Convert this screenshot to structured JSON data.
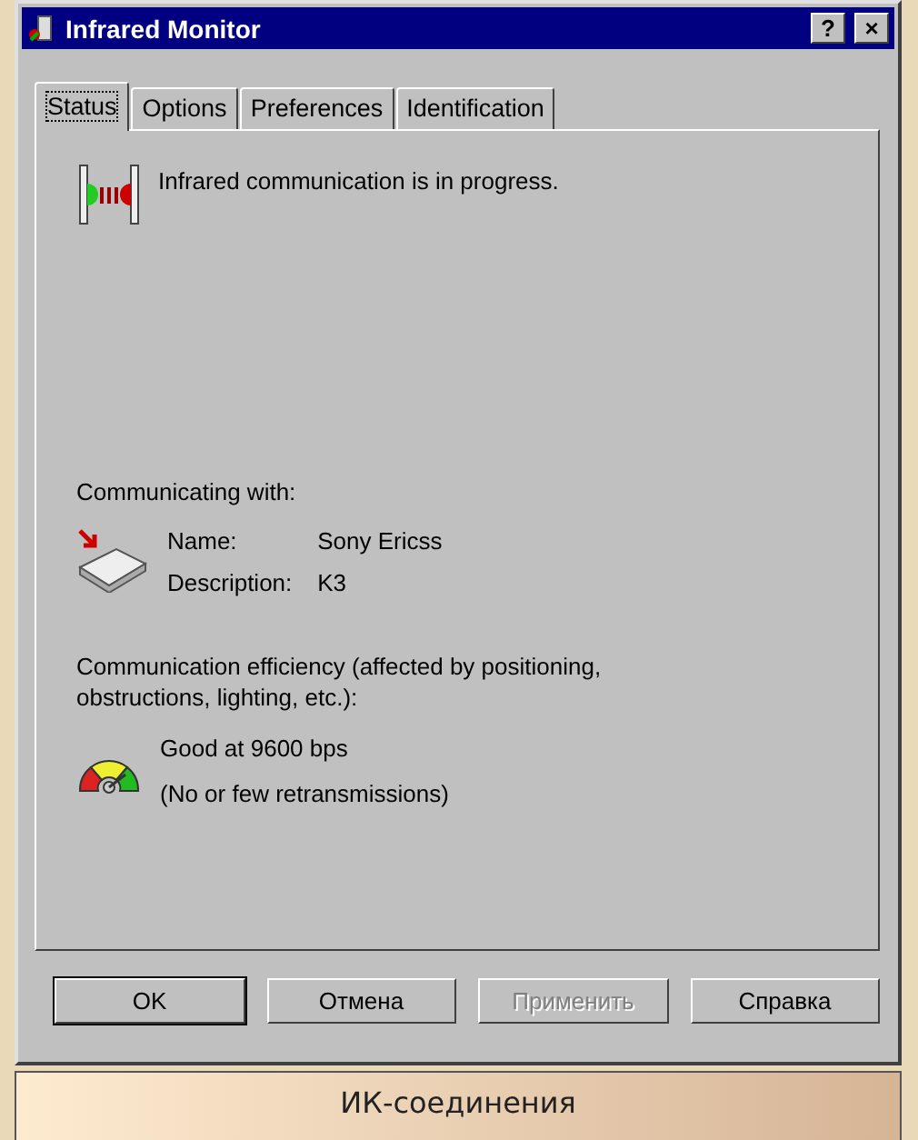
{
  "window": {
    "title": "Infrared Monitor",
    "help_button": "?",
    "close_button": "×"
  },
  "tabs": [
    {
      "label": "Status",
      "selected": true
    },
    {
      "label": "Options",
      "selected": false
    },
    {
      "label": "Preferences",
      "selected": false
    },
    {
      "label": "Identification",
      "selected": false
    }
  ],
  "status": {
    "message": "Infrared communication is in progress."
  },
  "device": {
    "heading": "Communicating with:",
    "fields": [
      {
        "label": "Name:",
        "value": "Sony Ericss"
      },
      {
        "label": "Description:",
        "value": "K3"
      }
    ]
  },
  "efficiency": {
    "heading": "Communication efficiency (affected by positioning, obstructions, lighting, etc.):",
    "rate": "Good at 9600 bps",
    "detail": "(No or few retransmissions)"
  },
  "buttons": [
    {
      "label": "OK",
      "default": true,
      "disabled": false
    },
    {
      "label": "Отмена",
      "default": false,
      "disabled": false
    },
    {
      "label": "Применить",
      "default": false,
      "disabled": true
    },
    {
      "label": "Справка",
      "default": false,
      "disabled": false
    }
  ],
  "caption": "ИК-соединения"
}
